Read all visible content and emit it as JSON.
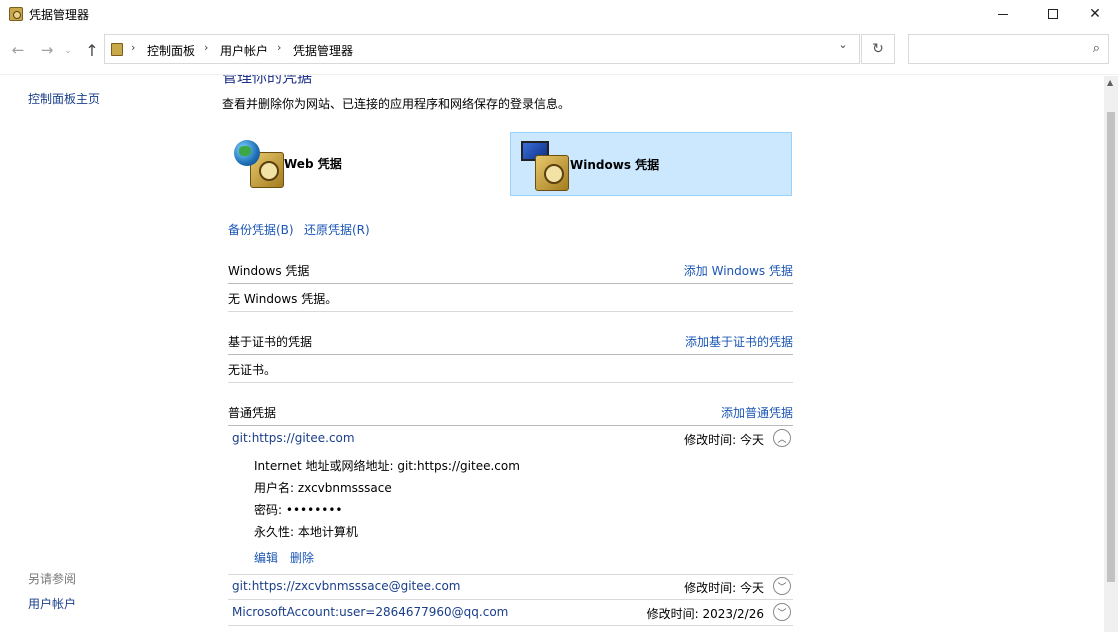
{
  "window": {
    "title": "凭据管理器",
    "minimize": "—",
    "maximize": "□",
    "close": "✕"
  },
  "nav": {
    "back": "←",
    "forward": "→",
    "recent": "⌄",
    "up": "↑",
    "breadcrumb": [
      "控制面板",
      "用户帐户",
      "凭据管理器"
    ],
    "refresh": "↻",
    "search_placeholder": ""
  },
  "sidebar": {
    "home": "控制面板主页",
    "see_also_label": "另请参阅",
    "user_accounts": "用户帐户"
  },
  "main": {
    "heading": "管理你的凭据",
    "subtitle": "查看并删除你为网站、已连接的应用程序和网络保存的登录信息。",
    "vault_web": "Web 凭据",
    "vault_windows": "Windows 凭据",
    "backup": "备份凭据(B)",
    "restore": "还原凭据(R)"
  },
  "sections": {
    "windows": {
      "title": "Windows 凭据",
      "action": "添加 Windows 凭据",
      "empty": "无 Windows 凭据。"
    },
    "cert": {
      "title": "基于证书的凭据",
      "action": "添加基于证书的凭据",
      "empty": "无证书。"
    },
    "generic": {
      "title": "普通凭据",
      "action": "添加普通凭据"
    }
  },
  "credentials": [
    {
      "name": "git:https://gitee.com",
      "modified": "修改时间:  今天",
      "expanded": true,
      "details": {
        "address_label": "Internet 地址或网络地址:",
        "address": "git:https://gitee.com",
        "user_label": "用户名:",
        "user": "zxcvbnmsssace",
        "password_label": "密码:",
        "password": "••••••••",
        "persistence_label": "永久性:",
        "persistence": "本地计算机",
        "edit": "编辑",
        "delete": "删除"
      }
    },
    {
      "name": "git:https://zxcvbnmsssace@gitee.com",
      "modified": "修改时间:  今天",
      "expanded": false
    },
    {
      "name": "MicrosoftAccount:user=2864677960@qq.com",
      "modified": "修改时间:  2023/2/26",
      "expanded": false
    }
  ],
  "icons": {
    "chevron_up": "︿",
    "chevron_down": "﹀",
    "search": "⌕"
  }
}
